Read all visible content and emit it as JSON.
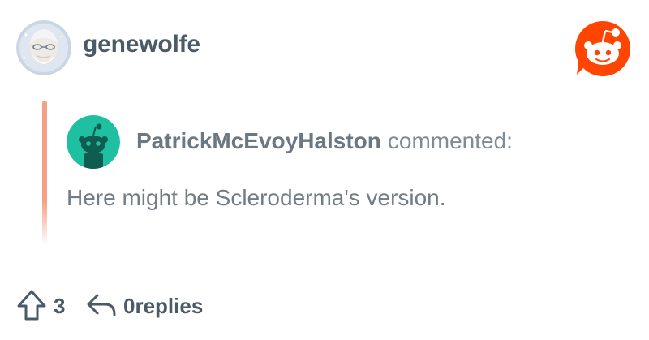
{
  "header": {
    "username": "genewolfe",
    "avatar_icon": "user-avatar-icon",
    "logo_icon": "reddit-logo-icon"
  },
  "quote": {
    "author": "PatrickMcEvoyHalston",
    "verb": "commented:",
    "text": "Here might be Scleroderma's version.",
    "avatar_icon": "snoo-avatar-icon",
    "bar_color": "#f3a287"
  },
  "footer": {
    "vote_count": "3",
    "replies_label": "0replies",
    "upvote_icon": "upvote-arrow-icon",
    "reply_icon": "reply-arrow-icon"
  },
  "colors": {
    "brand": "#ff4500",
    "text_dark": "#4a5a66",
    "text_muted": "#707c86",
    "snoo_avatar_bg": "#1fbfa2"
  }
}
